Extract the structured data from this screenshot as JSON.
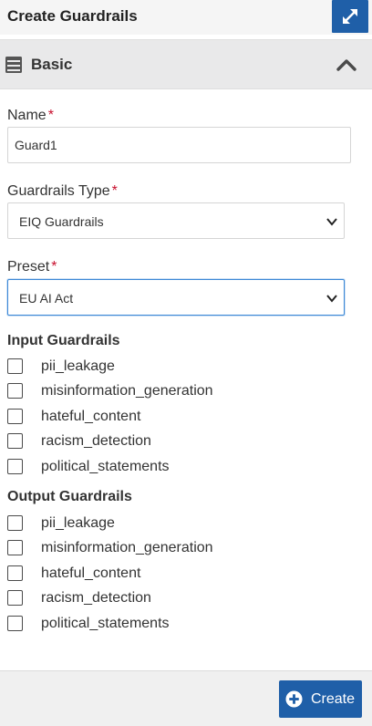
{
  "header": {
    "title": "Create Guardrails",
    "expand_icon": "expand-arrows-icon"
  },
  "section": {
    "title": "Basic",
    "icon": "server-icon",
    "toggle_icon": "chevron-up-icon"
  },
  "fields": {
    "name": {
      "label": "Name",
      "required_mark": "*",
      "value": "Guard1"
    },
    "type": {
      "label": "Guardrails Type",
      "required_mark": "*",
      "selected": "EIQ Guardrails"
    },
    "preset": {
      "label": "Preset",
      "required_mark": "*",
      "selected": "EU AI Act"
    }
  },
  "input_guardrails": {
    "title": "Input Guardrails",
    "items": [
      {
        "label": "pii_leakage",
        "checked": false
      },
      {
        "label": "misinformation_generation",
        "checked": false
      },
      {
        "label": "hateful_content",
        "checked": false
      },
      {
        "label": "racism_detection",
        "checked": false
      },
      {
        "label": "political_statements",
        "checked": false
      }
    ]
  },
  "output_guardrails": {
    "title": "Output Guardrails",
    "items": [
      {
        "label": "pii_leakage",
        "checked": false
      },
      {
        "label": "misinformation_generation",
        "checked": false
      },
      {
        "label": "hateful_content",
        "checked": false
      },
      {
        "label": "racism_detection",
        "checked": false
      },
      {
        "label": "political_statements",
        "checked": false
      }
    ]
  },
  "footer": {
    "create_label": "Create",
    "create_icon": "plus-circle-icon"
  },
  "colors": {
    "accent": "#1f5fa8",
    "required": "#c8102e",
    "focus": "#3b87d6"
  }
}
